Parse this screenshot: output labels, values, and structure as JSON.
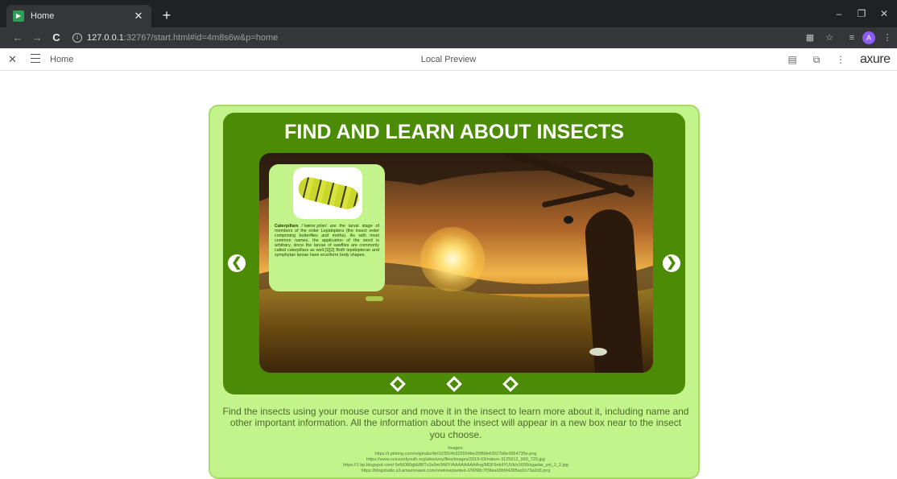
{
  "browser": {
    "tab_title": "Home",
    "tab_close": "✕",
    "new_tab": "+",
    "window_minimize": "–",
    "window_restore": "❐",
    "window_close": "✕",
    "nav_back": "←",
    "nav_forward": "→",
    "nav_reload": "C",
    "url_host": "127.0.0.1",
    "url_rest": ":32767/start.html#id=4m8s6w&p=home",
    "profile_initial": "A"
  },
  "axure_bar": {
    "close": "✕",
    "page_name": "Home",
    "center_label": "Local Preview",
    "logo": "axure"
  },
  "page": {
    "title": "FIND AND LEARN ABOUT INSECTS",
    "arrow_prev": "❮",
    "arrow_next": "❯",
    "info_name": "Caterpillars",
    "info_text": " /ˈkætərˌpɪlər/ are the larval stage of members of the order Lepidoptera (the insect order comprising butterflies and moths). As with most common names, the application of the word is arbitrary, since the larvae of sawflies are commonly called caterpillars as well.[1][2] Both lepidopteran and symphytan larvae have eruciform body shapes.",
    "description": "Find the insects using your mouse cursor and move it in the insect to learn more about it, including name and other important information. All the information about the insect will appear in a new box near to the insect you choose.",
    "images_heading": "Images:",
    "image_links": [
      "https://i.pinimg.com/originals/4b/32/55/4b325554be25f89b43927b8e3954735e.png",
      "https://www.voicesofyouth.org/sites/voy/files/images/2019-03/nature-3125912_960_720.jpg",
      "https://1.bp.blogspot.com/-5xNO80gbM8/Tv3e9m3tWY/AAAAAAAAAsg/MDF9nk4YUVk/s1600/agadar_yel_3_2.jpg",
      "https://blogstudio.s3.amazonaws.com/onetreeplanted-2/9098c7f38ea93fd94395ac0c73a2d3.png"
    ],
    "accent": "#4b8b05",
    "panel_bg": "#c2f48b"
  }
}
